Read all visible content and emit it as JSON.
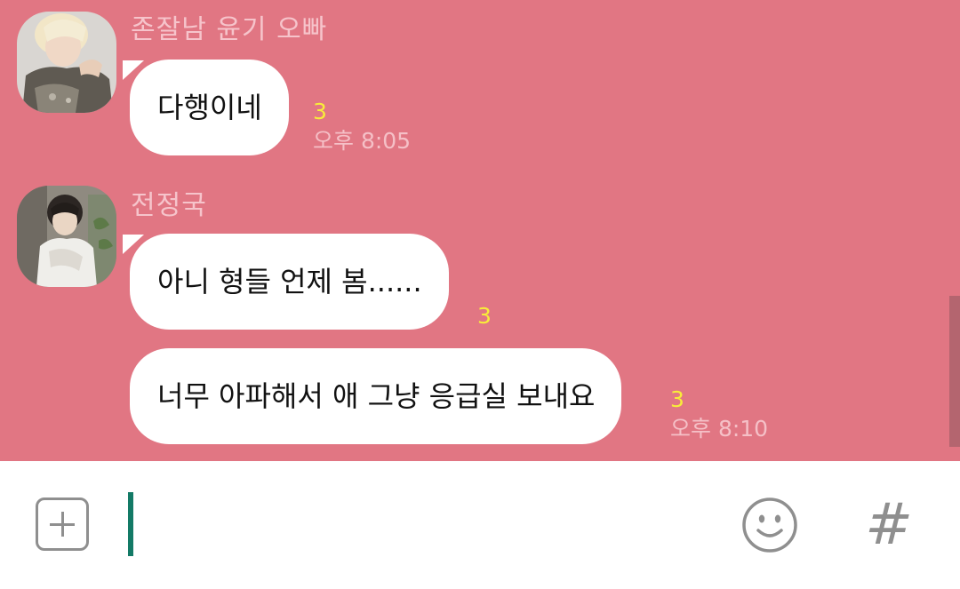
{
  "colors": {
    "chat_background": "#e17683",
    "bubble": "#ffffff",
    "unread_count": "#f8ec3a",
    "sender_name": "#f6c4cb",
    "cursor": "#137a66",
    "icon_gray": "#8f8f8f"
  },
  "messages": [
    {
      "sender": "존잘남 윤기 오빠",
      "bubbles": [
        {
          "text": "다행이네",
          "unread": "3"
        }
      ],
      "time": "오후 8:05"
    },
    {
      "sender": "전정국",
      "bubbles": [
        {
          "text": "아니 형들 언제 봄......",
          "unread": "3"
        },
        {
          "text": "너무 아파해서 애 그냥 응급실 보내요",
          "unread": "3"
        }
      ],
      "time": "오후 8:10"
    }
  ],
  "input_bar": {
    "add_icon": "plus-icon",
    "emoji_icon": "emoji-icon",
    "hashtag_label": "#"
  }
}
